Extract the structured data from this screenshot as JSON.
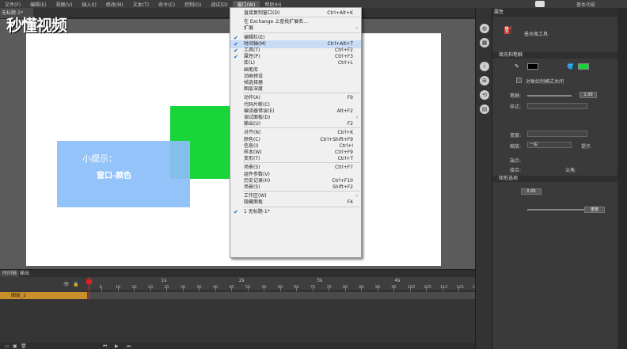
{
  "menubar": {
    "items": [
      "文件(F)",
      "编辑(E)",
      "视图(V)",
      "插入(I)",
      "修改(M)",
      "文本(T)",
      "命令(C)",
      "控制(O)",
      "调试(D)",
      "窗口(W)",
      "帮助(H)"
    ],
    "active_index": 9,
    "workspace_label": "基本功能"
  },
  "document_tab": "无标题-1*",
  "logo": "秒懂视频",
  "stage": {
    "tip_title": "小提示：",
    "tip_body": "窗口-颜色",
    "green_color": "#18d53a",
    "tip_color": "#8cbefa"
  },
  "window_menu": {
    "items": [
      {
        "label": "直接复制窗口(D)",
        "shortcut": "Ctrl+Alt+K",
        "checked": false,
        "submenu": false,
        "highlight": false
      },
      {
        "sep": true
      },
      {
        "label": "在 Exchange 上查找扩展名...",
        "shortcut": "",
        "checked": false,
        "submenu": false,
        "highlight": false
      },
      {
        "label": "扩展",
        "shortcut": "",
        "checked": false,
        "submenu": true,
        "highlight": false
      },
      {
        "sep": true
      },
      {
        "label": "编辑栏(E)",
        "shortcut": "",
        "checked": true,
        "submenu": false,
        "highlight": false
      },
      {
        "label": "时间轴(M)",
        "shortcut": "Ctrl+Alt+T",
        "checked": true,
        "submenu": false,
        "highlight": true
      },
      {
        "label": "工具(T)",
        "shortcut": "Ctrl+F2",
        "checked": true,
        "submenu": false,
        "highlight": false
      },
      {
        "label": "属性(P)",
        "shortcut": "Ctrl+F3",
        "checked": true,
        "submenu": false,
        "highlight": false
      },
      {
        "label": "库(L)",
        "shortcut": "Ctrl+L",
        "checked": false,
        "submenu": false,
        "highlight": false
      },
      {
        "label": "画笔库",
        "shortcut": "",
        "checked": false,
        "submenu": false,
        "highlight": false
      },
      {
        "label": "动画预设",
        "shortcut": "",
        "checked": false,
        "submenu": false,
        "highlight": false
      },
      {
        "label": "帧选择器",
        "shortcut": "",
        "checked": false,
        "submenu": false,
        "highlight": false
      },
      {
        "label": "图层深度",
        "shortcut": "",
        "checked": false,
        "submenu": false,
        "highlight": false
      },
      {
        "sep": true
      },
      {
        "label": "动作(A)",
        "shortcut": "F9",
        "checked": false,
        "submenu": false,
        "highlight": false
      },
      {
        "label": "代码片断(C)",
        "shortcut": "",
        "checked": false,
        "submenu": false,
        "highlight": false
      },
      {
        "label": "编译器错误(E)",
        "shortcut": "Alt+F2",
        "checked": false,
        "submenu": false,
        "highlight": false
      },
      {
        "label": "调试面板(D)",
        "shortcut": "",
        "checked": false,
        "submenu": true,
        "highlight": false
      },
      {
        "label": "输出(U)",
        "shortcut": "F2",
        "checked": false,
        "submenu": false,
        "highlight": false
      },
      {
        "sep": true
      },
      {
        "label": "对齐(N)",
        "shortcut": "Ctrl+K",
        "checked": false,
        "submenu": false,
        "highlight": false
      },
      {
        "label": "颜色(C)",
        "shortcut": "Ctrl+Shift+F9",
        "checked": false,
        "submenu": false,
        "highlight": false
      },
      {
        "label": "信息(I)",
        "shortcut": "Ctrl+I",
        "checked": false,
        "submenu": false,
        "highlight": false
      },
      {
        "label": "样本(W)",
        "shortcut": "Ctrl+F9",
        "checked": false,
        "submenu": false,
        "highlight": false
      },
      {
        "label": "变形(T)",
        "shortcut": "Ctrl+T",
        "checked": false,
        "submenu": false,
        "highlight": false
      },
      {
        "sep": true
      },
      {
        "label": "场景(S)",
        "shortcut": "Ctrl+F7",
        "checked": false,
        "submenu": false,
        "highlight": false
      },
      {
        "label": "组件参数(V)",
        "shortcut": "",
        "checked": false,
        "submenu": false,
        "highlight": false
      },
      {
        "label": "历史记录(H)",
        "shortcut": "Ctrl+F10",
        "checked": false,
        "submenu": false,
        "highlight": false
      },
      {
        "label": "场景(S)",
        "shortcut": "Shift+F2",
        "checked": false,
        "submenu": false,
        "highlight": false
      },
      {
        "sep": true
      },
      {
        "label": "工作区(W)",
        "shortcut": "",
        "checked": false,
        "submenu": true,
        "highlight": false
      },
      {
        "label": "隐藏面板",
        "shortcut": "F4",
        "checked": false,
        "submenu": false,
        "highlight": false
      },
      {
        "sep": true
      },
      {
        "label": "1 无标题-1*",
        "shortcut": "",
        "checked": true,
        "submenu": false,
        "highlight": false
      }
    ]
  },
  "timeline": {
    "tabs": [
      "时间轴",
      "输出"
    ],
    "layer_name": "图层_1",
    "seconds": [
      "1s",
      "2s",
      "3s",
      "4s"
    ],
    "frame_numbers": [
      "5",
      "10",
      "15",
      "20",
      "25",
      "30",
      "35",
      "40",
      "45",
      "50",
      "55",
      "60",
      "65",
      "70",
      "75",
      "80",
      "85",
      "90",
      "95",
      "100",
      "105",
      "110",
      "115",
      "120"
    ]
  },
  "properties": {
    "tab": "属性",
    "tool_name": "墨水瓶工具",
    "fill_stroke_header": "填充和笔触",
    "object_draw_mode": "对象绘制模式关闭",
    "stroke_label": "笔触:",
    "stroke_value": "1.00",
    "style_label": "样式:",
    "width_label": "宽度:",
    "scale_label": "缩放:",
    "scale_value": "一般",
    "hint_label": "提示",
    "cap_label": "端点:",
    "join_label": "接合:",
    "miter_label": "尖角:",
    "stroke_color": "#000000",
    "fill_color": "#18d53a",
    "round_header": "矩形选项",
    "corner_value": "0.00",
    "reset_label": "重置"
  }
}
